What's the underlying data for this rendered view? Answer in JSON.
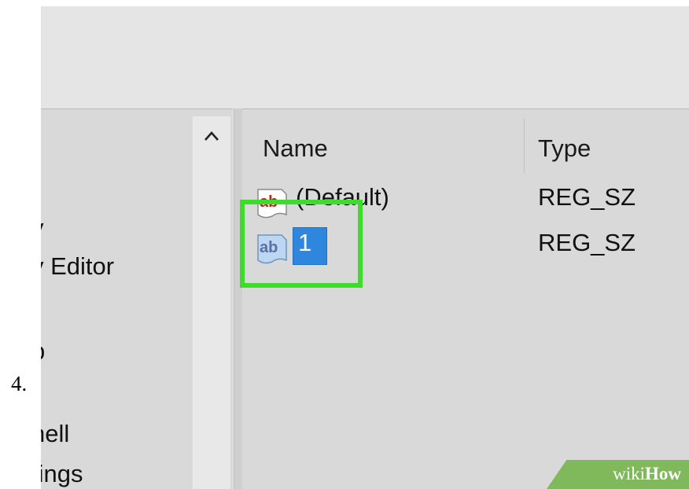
{
  "step_number": "4.",
  "tree": {
    "items": [
      {
        "label": "y"
      },
      {
        "label": "y Editor"
      },
      {
        "label": "p"
      },
      {
        "label": "hell"
      },
      {
        "label": "tings"
      }
    ]
  },
  "values_list": {
    "columns": {
      "name": "Name",
      "type": "Type"
    },
    "rows": [
      {
        "name": "(Default)",
        "type": "REG_SZ",
        "icon": "string-value-icon"
      },
      {
        "name": "1",
        "type": "REG_SZ",
        "icon": "string-value-icon",
        "editing": true
      }
    ]
  },
  "icons": {
    "scroll_up": "chevron-up-icon",
    "string_value": "string-value-icon"
  },
  "colors": {
    "highlight": "#3ddc2a",
    "selection": "#2f86dd",
    "watermark": "#7fb95c"
  },
  "watermark": {
    "prefix": "wiki",
    "suffix": "How"
  }
}
